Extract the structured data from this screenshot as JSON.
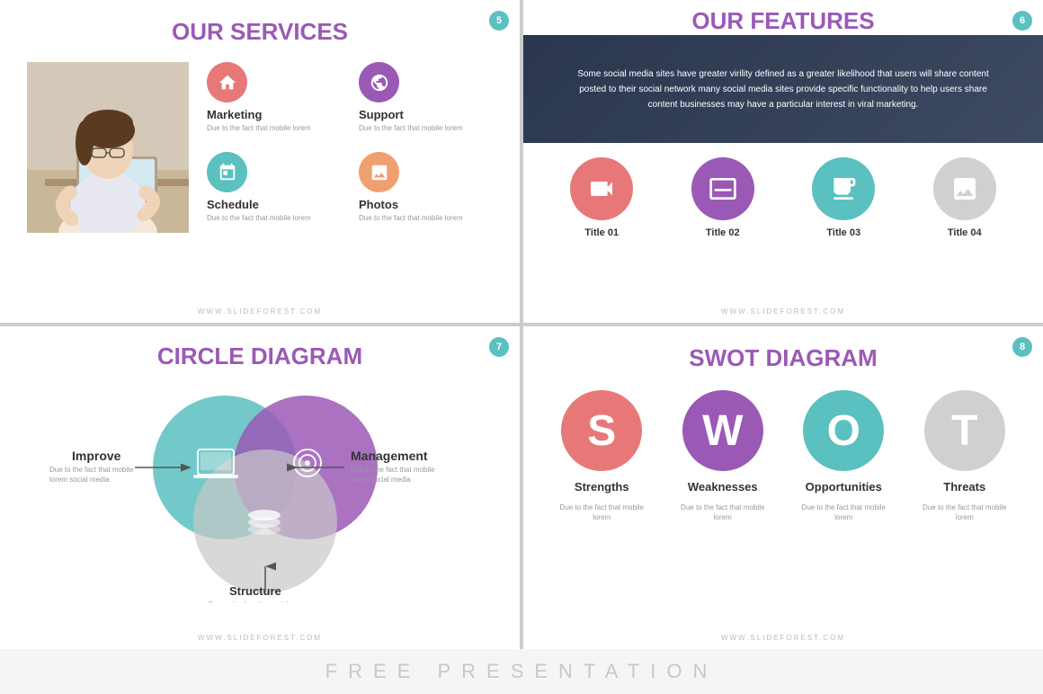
{
  "slides": {
    "slide1": {
      "badge": "5",
      "title_plain": "OUR",
      "title_accent": "SERVICES",
      "watermark": "WWW.SLIDEFOREST.COM",
      "services": [
        {
          "name": "Marketing",
          "desc": "Due to the fact that mobile lorem",
          "icon": "🏠",
          "color_class": "icon-pink"
        },
        {
          "name": "Support",
          "desc": "Due to the fact that mobile lorem",
          "icon": "🎯",
          "color_class": "icon-purple"
        },
        {
          "name": "Schedule",
          "desc": "Due to the fact that mobile lorem",
          "icon": "📅",
          "color_class": "icon-teal"
        },
        {
          "name": "Photos",
          "desc": "Due to the fact that mobile lorem",
          "icon": "🖼",
          "color_class": "icon-salmon"
        }
      ]
    },
    "slide2": {
      "badge": "6",
      "title_plain": "OUR",
      "title_accent": "FEATURES",
      "watermark": "WWW.SLIDEFOREST.COM",
      "header_text": "Some social media sites have greater virility defined as a greater likelihood that users will share content posted to their social network many social media sites provide specific functionality to help users share content businesses may have a particular interest in viral marketing.",
      "features": [
        {
          "label": "Title 01",
          "icon": "📹",
          "color_class": "fc-red"
        },
        {
          "label": "Title 02",
          "icon": "🖥",
          "color_class": "fc-purple"
        },
        {
          "label": "Title 03",
          "icon": "☕",
          "color_class": "fc-teal"
        },
        {
          "label": "Title 04",
          "icon": "🖼",
          "color_class": "fc-gray"
        }
      ]
    },
    "slide3": {
      "badge": "7",
      "title_plain": "CIRCLE",
      "title_accent": "DIAGRAM",
      "watermark": "WWW.SLIDEFOREST.COM",
      "labels": {
        "improve": {
          "title": "Improve",
          "desc": "Due to the fact that mobile lorem social media"
        },
        "management": {
          "title": "Management",
          "desc": "Due to the fact that mobile lorem social media"
        },
        "structure": {
          "title": "Structure",
          "desc": "Due to the fact that mobile lorem social media"
        }
      }
    },
    "slide4": {
      "badge": "8",
      "title_plain": "SWOT",
      "title_accent": "DIAGRAM",
      "watermark": "WWW.SLIDEFOREST.COM",
      "items": [
        {
          "letter": "S",
          "label": "Strengths",
          "desc": "Due to the fact that mobile lorem",
          "color_class": "sw-red"
        },
        {
          "letter": "W",
          "label": "Weaknesses",
          "desc": "Due to the fact that mobile lorem",
          "color_class": "sw-purple"
        },
        {
          "letter": "O",
          "label": "Opportunities",
          "desc": "Due to the fact that mobile lorem",
          "color_class": "sw-teal"
        },
        {
          "letter": "T",
          "label": "Threats",
          "desc": "Due to the fact that mobile lorem",
          "color_class": "sw-gray"
        }
      ]
    }
  },
  "footer": {
    "text": "FREE PRESENTATION"
  }
}
